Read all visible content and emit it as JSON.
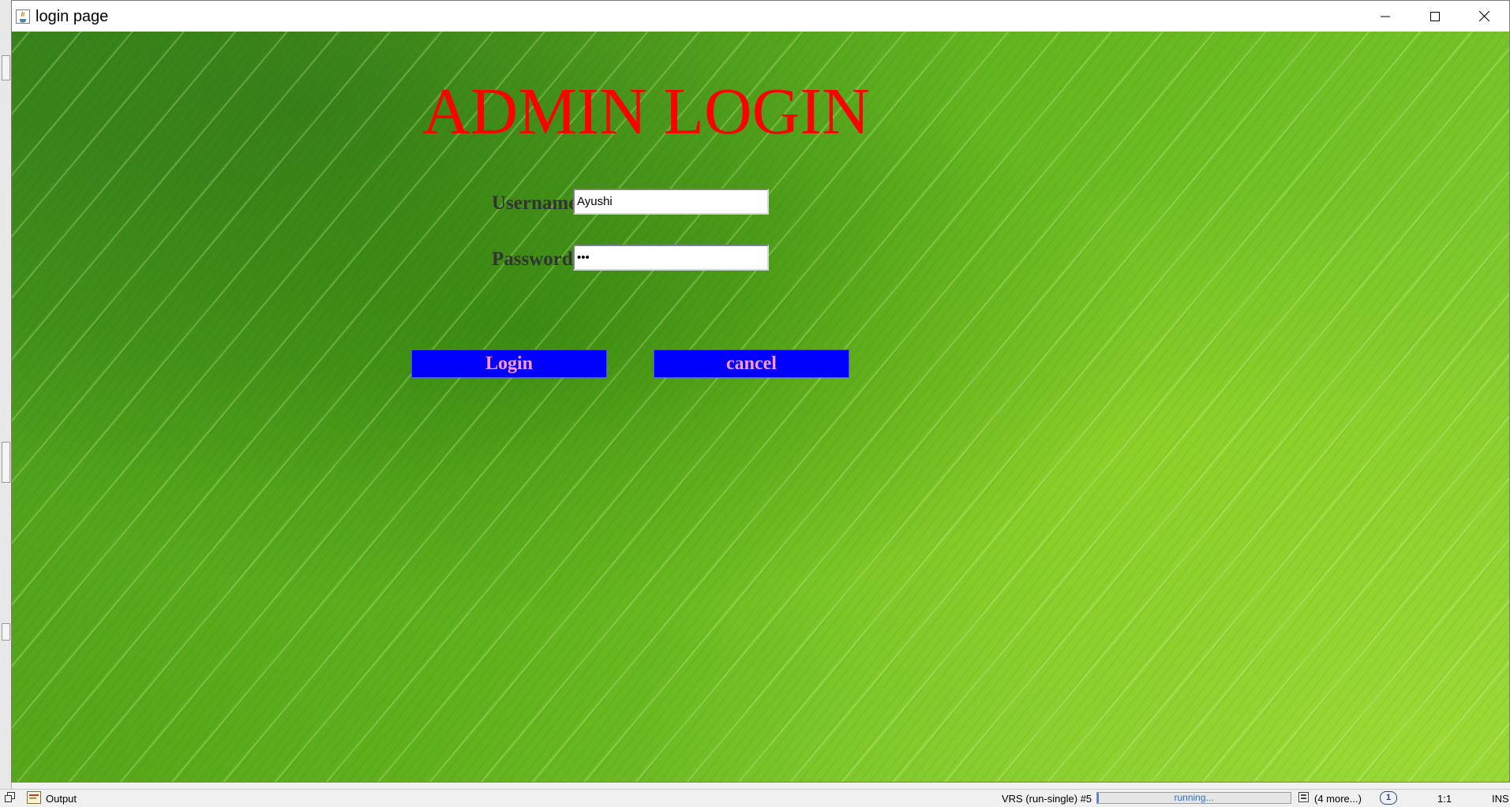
{
  "window": {
    "title": "login page",
    "controls": {
      "minimize": "minimize-icon",
      "maximize": "maximize-icon",
      "close": "close-icon"
    }
  },
  "form": {
    "heading": "ADMIN LOGIN",
    "username_label": "Username",
    "username_value": "Ayushi",
    "password_label": "Password",
    "password_value": "•••",
    "login_label": "Login",
    "cancel_label": "cancel"
  },
  "colors": {
    "heading": "#ff0000",
    "button_bg": "#0000ff",
    "button_text": "#ff99cc",
    "label_text": "#333333"
  },
  "statusbar": {
    "output_label": "Output",
    "task_label": "VRS (run-single) #5",
    "progress_text": "running...",
    "more_label": "(4 more...)",
    "notification_count": "1",
    "position": "1:1",
    "insert_mode": "INS"
  }
}
